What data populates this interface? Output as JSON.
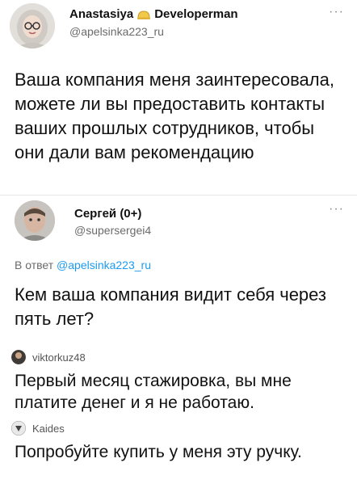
{
  "tweet1": {
    "name": "Anastasiya",
    "badge_icon": "hardhat-emoji-icon",
    "role": "Developerman",
    "handle": "@apelsinka223_ru",
    "text": "Ваша компания меня заинтересовала, можете ли вы предоставить контакты ваших прошлых сотрудников, чтобы они дали вам рекомендацию",
    "more": "···"
  },
  "tweet2": {
    "name": "Сергей (0+)",
    "handle": "@supersergei4",
    "reply_prefix": "В ответ",
    "reply_handle": "@apelsinka223_ru",
    "text": "Кем ваша компания видит себя через пять лет?",
    "more": "···"
  },
  "comments": [
    {
      "user": "viktorkuz48",
      "text": "Первый месяц стажировка, вы мне платите денег и я не работаю."
    },
    {
      "user": "Kaides",
      "text": "Попробуйте купить у меня эту ручку."
    }
  ],
  "colors": {
    "link": "#1d9bf0",
    "secondary": "#6b6b6b"
  }
}
